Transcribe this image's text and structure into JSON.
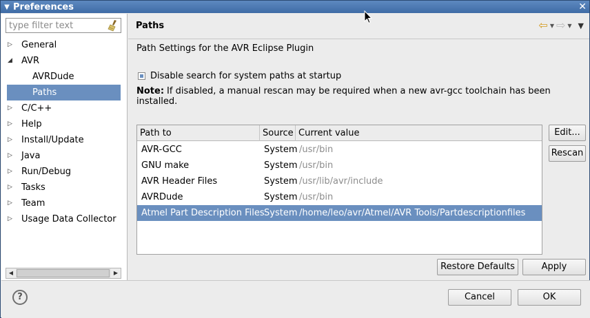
{
  "window": {
    "title": "Preferences"
  },
  "filter": {
    "placeholder": "type filter text",
    "value": ""
  },
  "tree": [
    {
      "label": "General",
      "expanded": false,
      "level": 0
    },
    {
      "label": "AVR",
      "expanded": true,
      "level": 0
    },
    {
      "label": "AVRDude",
      "level": 1
    },
    {
      "label": "Paths",
      "level": 1,
      "selected": true
    },
    {
      "label": "C/C++",
      "expanded": false,
      "level": 0
    },
    {
      "label": "Help",
      "expanded": false,
      "level": 0
    },
    {
      "label": "Install/Update",
      "expanded": false,
      "level": 0
    },
    {
      "label": "Java",
      "expanded": false,
      "level": 0
    },
    {
      "label": "Run/Debug",
      "expanded": false,
      "level": 0
    },
    {
      "label": "Tasks",
      "expanded": false,
      "level": 0
    },
    {
      "label": "Team",
      "expanded": false,
      "level": 0
    },
    {
      "label": "Usage Data Collector",
      "expanded": false,
      "level": 0
    }
  ],
  "page": {
    "title": "Paths",
    "description": "Path Settings for the AVR Eclipse Plugin",
    "checkbox_label": "Disable search for system paths at startup",
    "note_label": "Note:",
    "note_text": "If disabled, a manual rescan may be required when a new avr-gcc toolchain has been installed."
  },
  "table": {
    "headers": [
      "Path to",
      "Source",
      "Current value"
    ],
    "rows": [
      {
        "path": "AVR-GCC",
        "source": "System",
        "value": "/usr/bin"
      },
      {
        "path": "GNU make",
        "source": "System",
        "value": "/usr/bin"
      },
      {
        "path": "AVR Header Files",
        "source": "System",
        "value": "/usr/lib/avr/include"
      },
      {
        "path": "AVRDude",
        "source": "System",
        "value": "/usr/bin"
      },
      {
        "path": "Atmel Part Description Files",
        "source": "System",
        "value": "/home/leo/avr/Atmel/AVR Tools/Partdescriptionfiles",
        "selected": true
      }
    ]
  },
  "buttons": {
    "edit": "Edit...",
    "rescan": "Rescan",
    "restore_defaults": "Restore Defaults",
    "apply": "Apply",
    "cancel": "Cancel",
    "ok": "OK"
  },
  "colors": {
    "selection": "#6a8fbf",
    "titlebar": "#4a78b0"
  }
}
